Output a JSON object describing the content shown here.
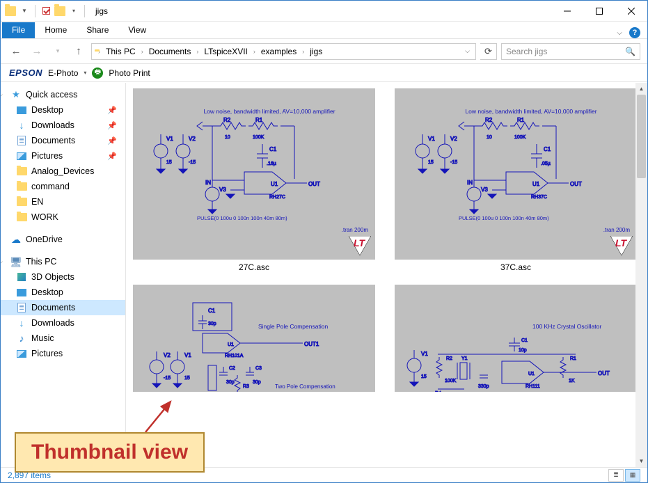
{
  "window": {
    "title": "jigs"
  },
  "ribbon": {
    "file": "File",
    "tabs": [
      "Home",
      "Share",
      "View"
    ]
  },
  "breadcrumb": {
    "segments": [
      "This PC",
      "Documents",
      "LTspiceXVII",
      "examples",
      "jigs"
    ]
  },
  "search": {
    "placeholder": "Search jigs"
  },
  "epson": {
    "logo": "EPSON",
    "ephoto": "E-Photo",
    "print": "Photo Print"
  },
  "sidebar": {
    "quick_access": {
      "label": "Quick access"
    },
    "qa_items": [
      {
        "label": "Desktop",
        "pinned": true
      },
      {
        "label": "Downloads",
        "pinned": true
      },
      {
        "label": "Documents",
        "pinned": true
      },
      {
        "label": "Pictures",
        "pinned": true
      },
      {
        "label": "Analog_Devices",
        "pinned": false
      },
      {
        "label": "command",
        "pinned": false
      },
      {
        "label": "EN",
        "pinned": false
      },
      {
        "label": "WORK",
        "pinned": false
      }
    ],
    "onedrive": {
      "label": "OneDrive"
    },
    "thispc": {
      "label": "This PC"
    },
    "pc_items": [
      {
        "label": "3D Objects"
      },
      {
        "label": "Desktop"
      },
      {
        "label": "Documents",
        "selected": true
      },
      {
        "label": "Downloads"
      },
      {
        "label": "Music"
      },
      {
        "label": "Pictures"
      }
    ]
  },
  "thumbs": [
    {
      "name": "27C.asc",
      "title": "Low noise, bandwidth limited,  AV=10,000 amplifier",
      "sub1": "RH27C",
      "note": ".tran 200m",
      "pulse": "PULSE(0 100u 0 100n 100n 40m 80m)"
    },
    {
      "name": "37C.asc",
      "title": "Low noise, bandwidth limited,  AV=10,000 amplifier",
      "sub1": "RH37C",
      "note": ".tran 200m",
      "pulse": "PULSE(0 100u 0 100n 100n 40m 80m)"
    },
    {
      "name": "",
      "title1": "Single Pole Compensation",
      "title2": "Two Pole Compensation",
      "sub1": "RH101A"
    },
    {
      "name": "",
      "title": "100 KHz Crystal Oscillator",
      "sub1": "RH111"
    }
  ],
  "status": {
    "items": "2,897 items"
  },
  "annotation": {
    "text": "Thumbnail view"
  }
}
